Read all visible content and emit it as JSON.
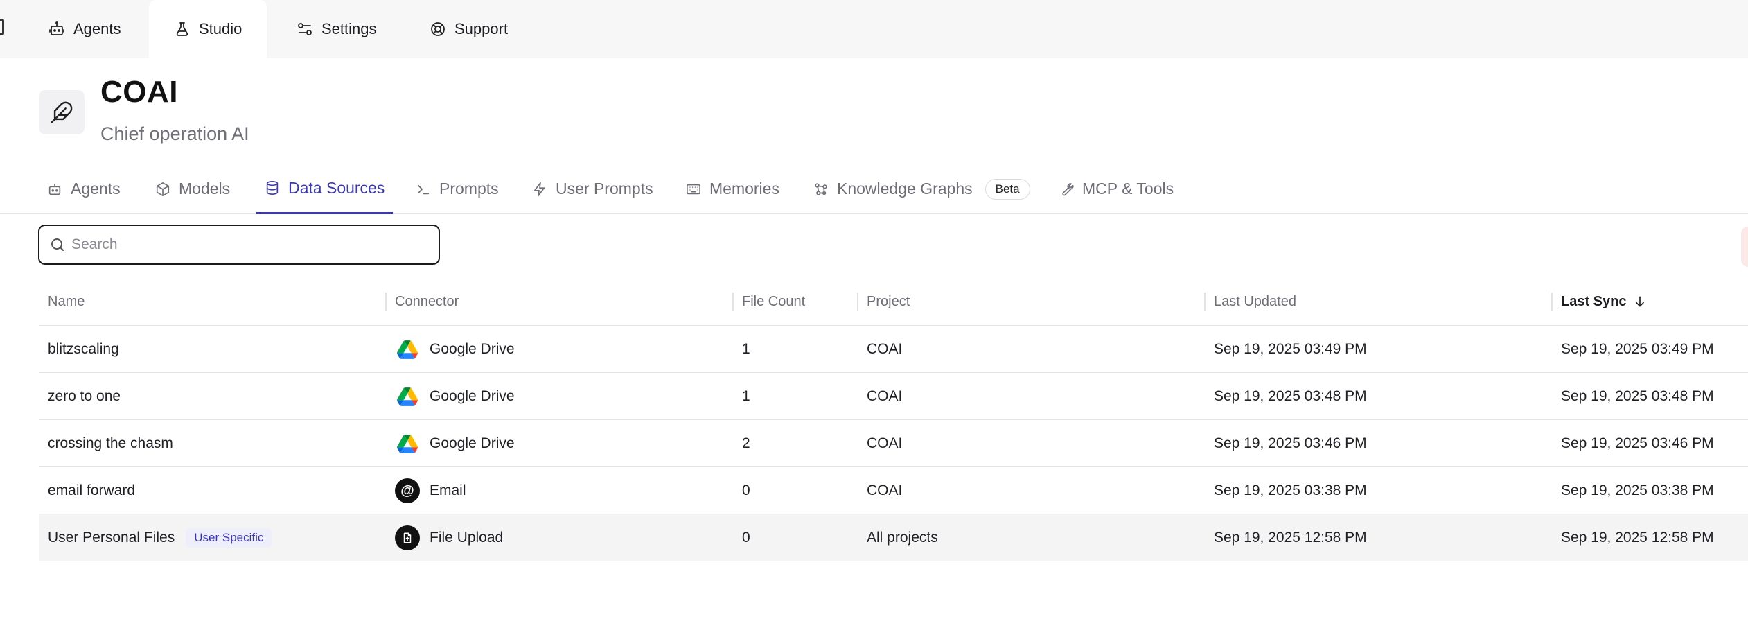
{
  "topnav": {
    "tabs": [
      {
        "label": "Agents",
        "icon": "robot-icon"
      },
      {
        "label": "Studio",
        "icon": "flask-icon",
        "active": true
      },
      {
        "label": "Settings",
        "icon": "sliders-icon"
      },
      {
        "label": "Support",
        "icon": "lifebuoy-icon"
      }
    ]
  },
  "header": {
    "icon": "feather-icon",
    "title": "COAI",
    "subtitle": "Chief operation AI"
  },
  "subtabs": [
    {
      "label": "Agents",
      "icon": "robot-icon"
    },
    {
      "label": "Models",
      "icon": "cube-icon"
    },
    {
      "label": "Data Sources",
      "icon": "database-icon",
      "active": true
    },
    {
      "label": "Prompts",
      "icon": "terminal-icon"
    },
    {
      "label": "User Prompts",
      "icon": "bolt-icon"
    },
    {
      "label": "Memories",
      "icon": "keyboard-icon"
    },
    {
      "label": "Knowledge Graphs",
      "icon": "graph-icon",
      "badge": "Beta"
    },
    {
      "label": "MCP & Tools",
      "icon": "wrench-icon"
    }
  ],
  "search": {
    "placeholder": "Search",
    "value": ""
  },
  "table": {
    "columns": [
      "Name",
      "Connector",
      "File Count",
      "Project",
      "Last Updated",
      "Last Sync"
    ],
    "sorted_column": "Last Sync",
    "sort_direction": "descending",
    "rows": [
      {
        "name": "blitzscaling",
        "connector": "Google Drive",
        "connector_icon": "google-drive-icon",
        "file_count": "1",
        "project": "COAI",
        "last_updated": "Sep 19, 2025 03:49 PM",
        "last_sync": "Sep 19, 2025 03:49 PM"
      },
      {
        "name": "zero to one",
        "connector": "Google Drive",
        "connector_icon": "google-drive-icon",
        "file_count": "1",
        "project": "COAI",
        "last_updated": "Sep 19, 2025 03:48 PM",
        "last_sync": "Sep 19, 2025 03:48 PM"
      },
      {
        "name": "crossing the chasm",
        "connector": "Google Drive",
        "connector_icon": "google-drive-icon",
        "file_count": "2",
        "project": "COAI",
        "last_updated": "Sep 19, 2025 03:46 PM",
        "last_sync": "Sep 19, 2025 03:46 PM"
      },
      {
        "name": "email forward",
        "connector": "Email",
        "connector_icon": "email-at-icon",
        "file_count": "0",
        "project": "COAI",
        "last_updated": "Sep 19, 2025 03:38 PM",
        "last_sync": "Sep 19, 2025 03:38 PM"
      },
      {
        "name": "User Personal Files",
        "badge": "User Specific",
        "connector": "File Upload",
        "connector_icon": "file-upload-icon",
        "file_count": "0",
        "project": "All projects",
        "last_updated": "Sep 19, 2025 12:58 PM",
        "last_sync": "Sep 19, 2025 12:58 PM",
        "highlighted": true
      }
    ]
  },
  "colors": {
    "accent": "#3a36b8",
    "topnav_bg": "#f7f7f8",
    "muted_text": "#6d6d75",
    "row_highlight": "#f4f4f5"
  }
}
